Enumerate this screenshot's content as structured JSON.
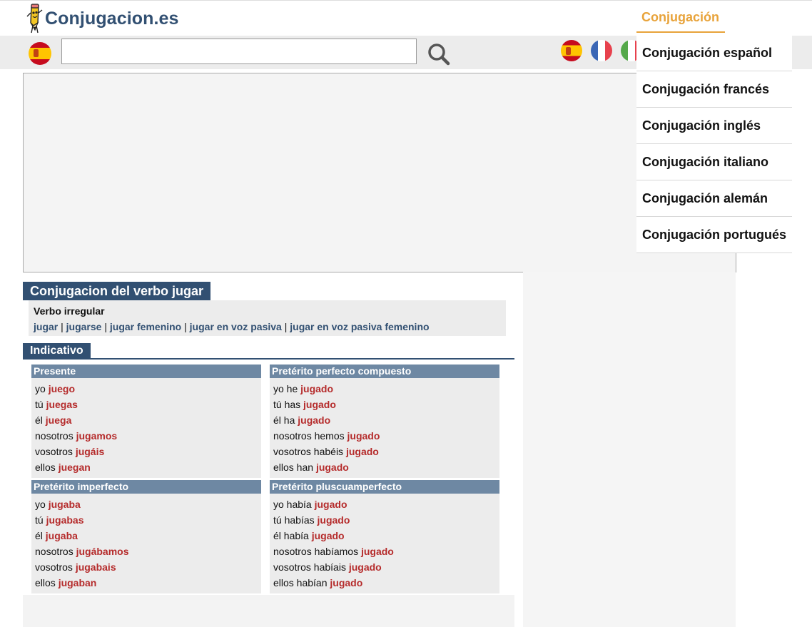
{
  "site": {
    "logo_text": "Conjugacion.es"
  },
  "nav": {
    "conjugacion_label": "Conjugación"
  },
  "search": {
    "value": "",
    "placeholder": ""
  },
  "dropdown": {
    "items": [
      "Conjugación español",
      "Conjugación francés",
      "Conjugación inglés",
      "Conjugación italiano",
      "Conjugación alemán",
      "Conjugación portugués"
    ]
  },
  "main": {
    "title": "Conjugacion del verbo jugar",
    "verb_type": "Verbo irregular",
    "links": [
      "jugar",
      "jugarse",
      "jugar femenino",
      "jugar en voz pasiva",
      "jugar en voz pasiva femenino"
    ],
    "separator": " | ",
    "mood": "Indicativo",
    "tenses": [
      {
        "name": "Presente",
        "rows": [
          {
            "pronoun": "yo",
            "form": "juego"
          },
          {
            "pronoun": "tú",
            "form": "juegas"
          },
          {
            "pronoun": "él",
            "form": "juega"
          },
          {
            "pronoun": "nosotros",
            "form": "jugamos"
          },
          {
            "pronoun": "vosotros",
            "form": "jugáis"
          },
          {
            "pronoun": "ellos",
            "form": "juegan"
          }
        ]
      },
      {
        "name": "Pretérito perfecto compuesto",
        "rows": [
          {
            "pronoun": "yo he",
            "form": "jugado"
          },
          {
            "pronoun": "tú has",
            "form": "jugado"
          },
          {
            "pronoun": "él ha",
            "form": "jugado"
          },
          {
            "pronoun": "nosotros hemos",
            "form": "jugado"
          },
          {
            "pronoun": "vosotros habéis",
            "form": "jugado"
          },
          {
            "pronoun": "ellos han",
            "form": "jugado"
          }
        ]
      },
      {
        "name": "Pretérito imperfecto",
        "rows": [
          {
            "pronoun": "yo",
            "form": "jugaba"
          },
          {
            "pronoun": "tú",
            "form": "jugabas"
          },
          {
            "pronoun": "él",
            "form": "jugaba"
          },
          {
            "pronoun": "nosotros",
            "form": "jugábamos"
          },
          {
            "pronoun": "vosotros",
            "form": "jugabais"
          },
          {
            "pronoun": "ellos",
            "form": "jugaban"
          }
        ]
      },
      {
        "name": "Pretérito pluscuamperfecto",
        "rows": [
          {
            "pronoun": "yo había",
            "form": "jugado"
          },
          {
            "pronoun": "tú habías",
            "form": "jugado"
          },
          {
            "pronoun": "él había",
            "form": "jugado"
          },
          {
            "pronoun": "nosotros habíamos",
            "form": "jugado"
          },
          {
            "pronoun": "vosotros habíais",
            "form": "jugado"
          },
          {
            "pronoun": "ellos habían",
            "form": "jugado"
          }
        ]
      }
    ]
  },
  "colors": {
    "brand": "#325072",
    "accent": "#e8a33a",
    "tense_header": "#6e88a3",
    "verb_form": "#b52b2b"
  },
  "icons": {
    "logo": "pencil-mascot-icon",
    "search": "search-icon",
    "flags": [
      "spain-flag-icon",
      "spain-flag-icon",
      "france-flag-icon",
      "italy-flag-icon"
    ]
  }
}
